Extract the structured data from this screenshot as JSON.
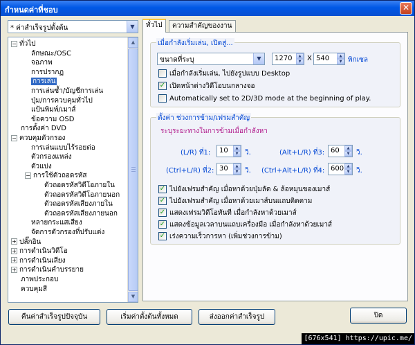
{
  "window": {
    "title": "กำหนดค่าที่ชอบ",
    "close_symbol": "✕"
  },
  "preset": {
    "value": "* ค่าสำเร็จรูปตั้งต้น",
    "arrow": "▼"
  },
  "tree": {
    "items": [
      {
        "label": "ทั่วไป",
        "level": 0,
        "expander": "−"
      },
      {
        "label": "ลักษณะ/OSC",
        "level": 1
      },
      {
        "label": "จอภาพ",
        "level": 1
      },
      {
        "label": "การปรากฏ",
        "level": 1
      },
      {
        "label": "การเล่น",
        "level": 1,
        "selected": true
      },
      {
        "label": "การเล่นซ้ำ/บัญชีการเล่น",
        "level": 1
      },
      {
        "label": "ปุ่ม/การควบคุมทั่วไป",
        "level": 1
      },
      {
        "label": "แป้นพิมพ์/เมาส์",
        "level": 1
      },
      {
        "label": "ข้อความ OSD",
        "level": 1
      },
      {
        "label": "การตั้งค่า DVD",
        "level": 0
      },
      {
        "label": "ควบคุมตัวกรอง",
        "level": 0,
        "expander": "−"
      },
      {
        "label": "การเล่นแบบไร้รอยต่อ",
        "level": 1
      },
      {
        "label": "ตัวกรองแหล่ง",
        "level": 1
      },
      {
        "label": "ตัวแบ่ง",
        "level": 1
      },
      {
        "label": "การใช้ตัวถอดรหัส",
        "level": 1,
        "expander": "−"
      },
      {
        "label": "ตัวถอดรหัสวิดีโอภายใน",
        "level": 2
      },
      {
        "label": "ตัวถอดรหัสวิดีโอภายนอก",
        "level": 2
      },
      {
        "label": "ตัวถอดรหัสเสียงภายใน",
        "level": 2
      },
      {
        "label": "ตัวถอดรหัสเสียงภายนอก",
        "level": 2
      },
      {
        "label": "หลายกระแสเสียง",
        "level": 1
      },
      {
        "label": "จัดการตัวกรองที่ปรับแต่ง",
        "level": 1
      },
      {
        "label": "ปลั๊กอิน",
        "level": 0,
        "expander": "+"
      },
      {
        "label": "การดำเนินวิดีโอ",
        "level": 0,
        "expander": "+"
      },
      {
        "label": "การดำเนินเสียง",
        "level": 0,
        "expander": "+"
      },
      {
        "label": "การดำเนินคำบรรยาย",
        "level": 0,
        "expander": "+"
      },
      {
        "label": "ภาพประกอบ",
        "level": 0
      },
      {
        "label": "ควบคุมสี",
        "level": 0
      }
    ]
  },
  "tabs": [
    {
      "label": "ทั่วไป",
      "active": true
    },
    {
      "label": "ความสำคัญของงาน",
      "active": false
    }
  ],
  "playback_group": {
    "title": "เมื่อกำลังเริ่มเล่น, เปิดสู่...",
    "size_mode": "ขนาดที่ระบุ",
    "width": "1270",
    "x_label": "X",
    "height": "540",
    "unit": "พิกเซล",
    "options": [
      {
        "label": "เมื่อกำลังเริ่มเล่น, ไปยังรูปแบบ Desktop",
        "checked": false
      },
      {
        "label": "เปิดหน้าต่างวิดีโอบนกลางจอ",
        "checked": true
      },
      {
        "label": "Automatically set to 2D/3D mode at the beginning of play.",
        "checked": false
      }
    ]
  },
  "seek_group": {
    "title": "ตั้งค่า ช่วงการข้าม/เฟรมสำคัญ",
    "subtitle": "ระบุระยะทางในการข้ามเมื่อกำลังหา",
    "fields": [
      {
        "label": "(L/R) ที่1:",
        "value": "10",
        "unit": "วิ."
      },
      {
        "label": "(Alt+L/R) ที่3:",
        "value": "60",
        "unit": "วิ."
      },
      {
        "label": "(Ctrl+L/R) ที่2:",
        "value": "30",
        "unit": "วิ."
      },
      {
        "label": "(Ctrl+Alt+L/R) ที่4:",
        "value": "600",
        "unit": "วิ."
      }
    ],
    "options": [
      {
        "label": "ไปยังเฟรมสำคัญ เมื่อหาด้วยปุ่มลัด & ล้อหมุนของเมาส์",
        "checked": true
      },
      {
        "label": "ไปยังเฟรมสำคัญ เมื่อหาด้วยเมาส์บนแถบติดตาม",
        "checked": true
      },
      {
        "label": "แสดงเฟรมวิดีโอทันที เมื่อกำลังหาด้วยเมาส์",
        "checked": true
      },
      {
        "label": "แสดงข้อมูลเวลาบนแถบเครื่องมือ เมื่อกำลังหาด้วยเมาส์",
        "checked": true
      },
      {
        "label": "เร่งความเร็วการหา (เพิ่มช่วงการข้าม)",
        "checked": true
      }
    ]
  },
  "buttons": {
    "restore_preset": "คืนค่าสำเร็จรูปปัจจุบัน",
    "reset_all": "เริ่มค่าตั้งต้นทั้งหมด",
    "export_preset": "ส่งออกค่าสำเร็จรูป",
    "close": "ปิด"
  },
  "watermark": "[676x541] https://upic.me/"
}
